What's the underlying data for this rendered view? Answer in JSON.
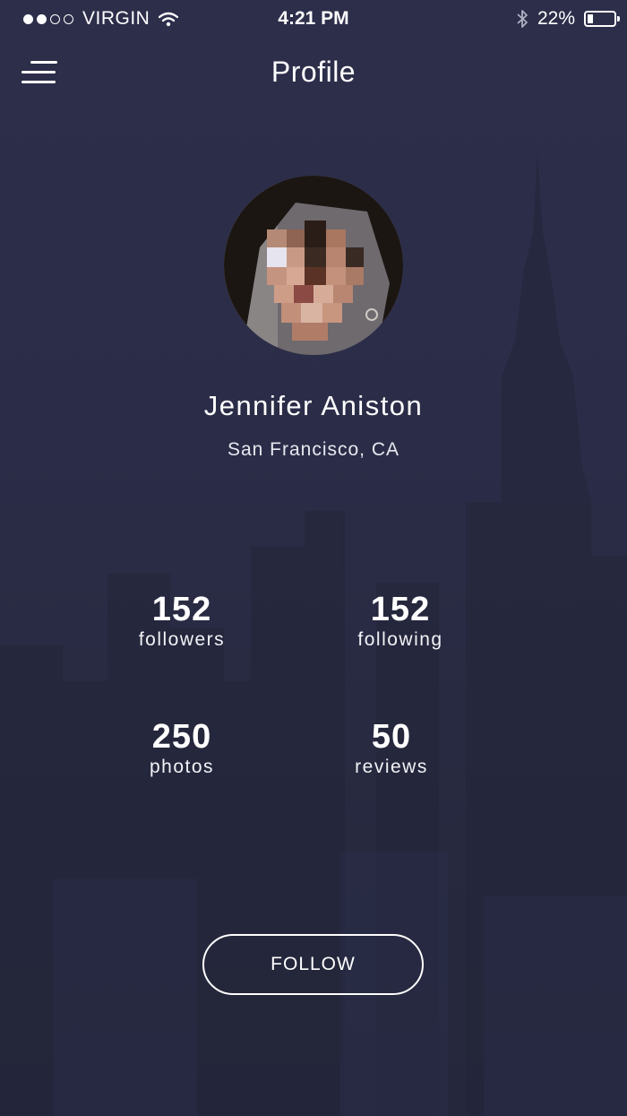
{
  "status_bar": {
    "signal_dots": [
      true,
      true,
      false,
      false
    ],
    "carrier": "VIRGIN",
    "time": "4:21 PM",
    "battery_text": "22%",
    "battery_level": 0.22
  },
  "nav": {
    "title": "Profile"
  },
  "profile": {
    "name": "Jennifer Aniston",
    "location": "San Francisco, CA"
  },
  "stats": [
    {
      "value": "152",
      "label": "followers"
    },
    {
      "value": "152",
      "label": "following"
    },
    {
      "value": "250",
      "label": "photos"
    },
    {
      "value": "50",
      "label": "reviews"
    }
  ],
  "actions": {
    "follow_label": "FOLLOW"
  },
  "colors": {
    "background": "#2b2d48",
    "text": "#ffffff"
  }
}
